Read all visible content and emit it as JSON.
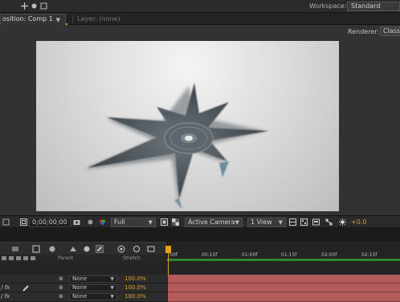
{
  "workspace": {
    "label": "Workspace:",
    "value": "Standard"
  },
  "tabs": {
    "active": "osition: Comp 1",
    "inactive": "Layer: (none)"
  },
  "viewer": {
    "renderer_label": "Renderer:",
    "renderer_value": "Classic"
  },
  "viewer_controls": {
    "timecode": "0;00;00;00",
    "resolution": "Full",
    "camera": "Active Camera",
    "views": "1 View",
    "exposure": "+0.0"
  },
  "timeline": {
    "headers": {
      "parent": "Parent",
      "stretch": "Stretch"
    },
    "ruler_labels": [
      "00f",
      "00:15f",
      "01:00f",
      "01:15f",
      "02:00f",
      "02:15f"
    ],
    "layers": [
      {
        "parent": "None",
        "stretch": "100.0%"
      },
      {
        "parent": "None",
        "stretch": "100.0%"
      },
      {
        "parent": "None",
        "stretch": "100.0%"
      }
    ]
  },
  "colors": {
    "accent": "#e39b2b",
    "work_area": "#2c8a2c",
    "layer_track": "#b35a5a"
  }
}
